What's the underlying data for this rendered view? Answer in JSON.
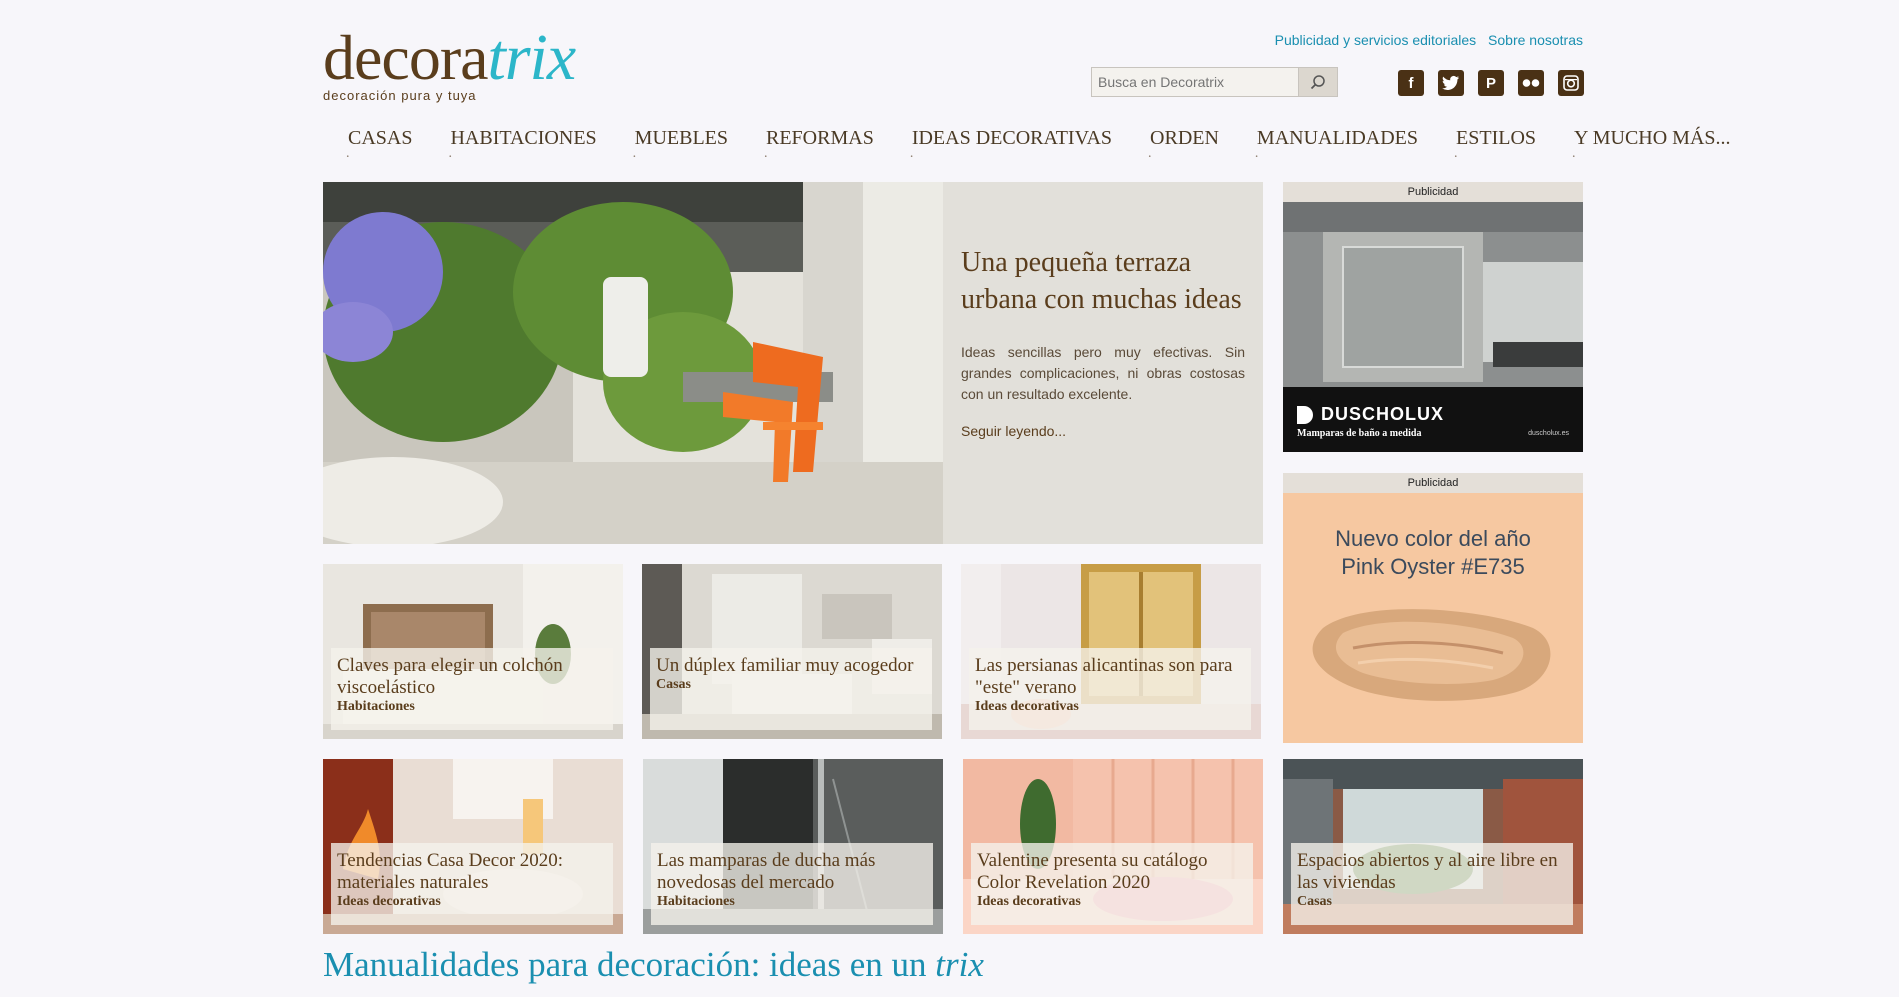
{
  "logo": {
    "part1": "decora",
    "part2": "trix",
    "tagline": "decoración pura y tuya"
  },
  "toplinks": [
    "Publicidad y servicios editoriales",
    "Sobre nosotras"
  ],
  "search": {
    "placeholder": "Busca en Decoratrix"
  },
  "socials": [
    {
      "icon": "facebook-icon",
      "glyph": "f"
    },
    {
      "icon": "twitter-icon",
      "glyph": "t"
    },
    {
      "icon": "pinterest-icon",
      "glyph": "P"
    },
    {
      "icon": "flickr-icon",
      "glyph": "••"
    },
    {
      "icon": "instagram-icon",
      "glyph": "◘"
    }
  ],
  "nav": [
    "CASAS",
    "HABITACIONES",
    "MUEBLES",
    "REFORMAS",
    "IDEAS DECORATIVAS",
    "ORDEN",
    "MANUALIDADES",
    "ESTILOS",
    "Y MUCHO MÁS..."
  ],
  "hero": {
    "title": "Una pequeña terraza urbana con muchas ideas",
    "description": "Ideas sencillas pero muy efectivas. Sin grandes complicaciones, ni obras costosas con un resultado excelente.",
    "more": "Seguir leyendo..."
  },
  "cards": [
    {
      "title": "Claves para elegir un colchón viscoelástico",
      "category": "Habitaciones"
    },
    {
      "title": "Un dúplex familiar muy acogedor",
      "category": "Casas"
    },
    {
      "title": "Las persianas alicantinas son para \"este\" verano",
      "category": "Ideas decorativas"
    },
    {
      "title": "Tendencias Casa Decor 2020: materiales naturales",
      "category": "Ideas decorativas"
    },
    {
      "title": "Las mamparas de ducha más novedosas del mercado",
      "category": "Habitaciones"
    },
    {
      "title": "Valentine presenta su catálogo Color Revelation 2020",
      "category": "Ideas decorativas"
    },
    {
      "title": "Espacios abiertos y al aire libre en las viviendas",
      "category": "Casas"
    }
  ],
  "ads": [
    {
      "label": "Publicidad",
      "brand": "DUSCHOLUX",
      "tagline": "Mamparas de baño a medida",
      "url": "duscholux.es"
    },
    {
      "label": "Publicidad",
      "line1": "Nuevo color del año",
      "line2": "Pink Oyster #E735"
    }
  ],
  "section": {
    "title_main": "Manualidades para decoración: ideas en un ",
    "title_italic": "trix"
  }
}
